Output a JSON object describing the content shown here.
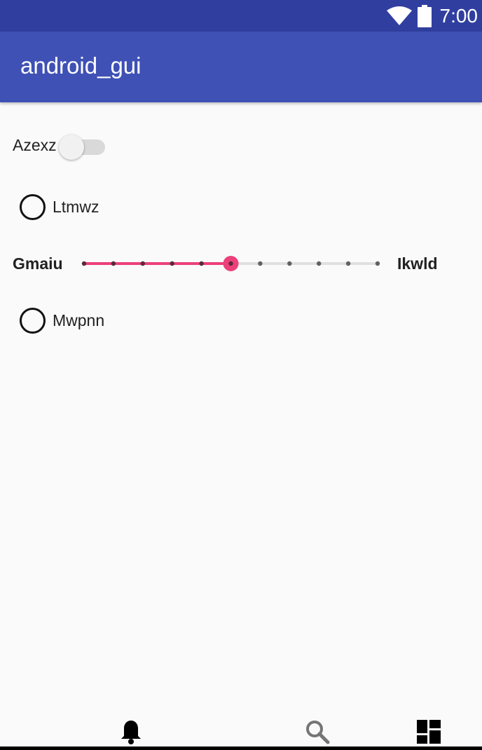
{
  "status_bar": {
    "time": "7:00",
    "icons": [
      "wifi-icon",
      "battery-icon"
    ],
    "color": "#303f9f"
  },
  "app_bar": {
    "title": "android_gui",
    "color": "#3f51b5"
  },
  "switch": {
    "label": "Azexz",
    "checked": false
  },
  "radio_1": {
    "label": "Ltmwz",
    "checked": false
  },
  "slider": {
    "left_label": "Gmaiu",
    "right_label": "Ikwld",
    "min": 0,
    "max": 10,
    "value": 5,
    "accent_color": "#ec407a"
  },
  "radio_2": {
    "label": "Mwpnn",
    "checked": false
  },
  "bottom_nav": {
    "items": [
      {
        "icon": "bell-icon"
      },
      {
        "icon": "search-icon"
      },
      {
        "icon": "dashboard-icon"
      }
    ]
  }
}
